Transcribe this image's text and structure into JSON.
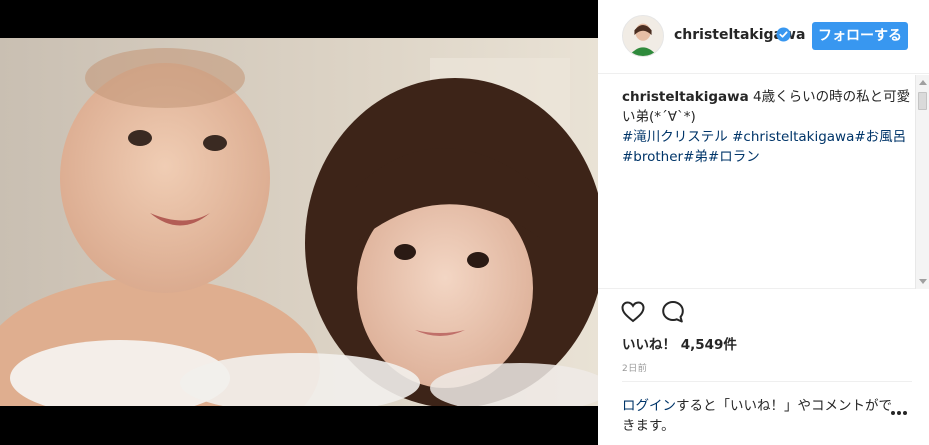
{
  "post": {
    "username": "christeltakigawa",
    "follow_label": "フォローする",
    "caption_user": "christeltakigawa",
    "caption_text": " 4歳くらいの時の私と可愛い弟(*´∀`*)",
    "hashtags": [
      {
        "text": "#滝川クリステル",
        "sep": " "
      },
      {
        "text": "#christeltakigawa",
        "sep": ""
      },
      {
        "text": "#お風呂",
        "sep": ""
      },
      {
        "text": "#brother",
        "sep": ""
      },
      {
        "text": "#弟",
        "sep": ""
      },
      {
        "text": "#ロラン",
        "sep": ""
      }
    ],
    "likes_label": "いいね！",
    "likes_count": "4,549件",
    "timestamp": "2日前",
    "login_link": "ログイン",
    "login_rest": "すると「いいね！」やコメントができます。"
  },
  "icons": {
    "verified": "verified-badge-icon",
    "heart": "heart-outline-icon",
    "comment": "comment-bubble-icon",
    "more": "more-options-icon"
  },
  "colors": {
    "accent": "#3897f0",
    "link": "#003569",
    "text": "#262626",
    "muted": "#999999"
  }
}
